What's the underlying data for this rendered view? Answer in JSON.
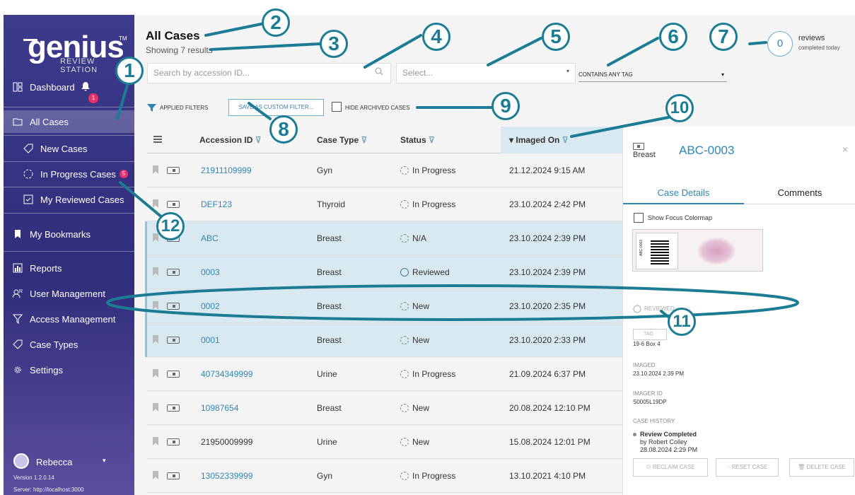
{
  "brand": {
    "name": "genius",
    "tm": "TM",
    "subtitle": "REVIEW STATION"
  },
  "sidebar": {
    "dashboard": {
      "label": "Dashboard",
      "bell_count": "1"
    },
    "items": [
      {
        "label": "All Cases",
        "icon": "folder-icon"
      },
      {
        "label": "New Cases",
        "icon": "tag-icon"
      },
      {
        "label": "In Progress Cases",
        "icon": "progress-icon",
        "badge": "5"
      },
      {
        "label": "My Reviewed Cases",
        "icon": "checkbox-icon"
      },
      {
        "label": "My Bookmarks",
        "icon": "bookmark-icon"
      },
      {
        "label": "Reports",
        "icon": "reports-icon"
      },
      {
        "label": "User Management",
        "icon": "users-icon"
      },
      {
        "label": "Access Management",
        "icon": "access-icon"
      },
      {
        "label": "Case Types",
        "icon": "tag-icon"
      },
      {
        "label": "Settings",
        "icon": "gear-icon"
      }
    ],
    "user": "Rebecca",
    "version": "Version 1.2.0.14",
    "server": "Server: http://localhost:3000"
  },
  "header": {
    "title": "All Cases",
    "results": "Showing 7 results",
    "search_placeholder": "Search by accession ID...",
    "select_placeholder": "Select...",
    "tag_mode": "CONTAINS ANY TAG",
    "reviews_count": "0",
    "reviews_label": "reviews",
    "reviews_sub": "completed today"
  },
  "filters": {
    "applied": "APPLIED FILTERS",
    "save_custom": "SAVE AS CUSTOM FILTER...",
    "hide_archived": "HIDE ARCHIVED CASES"
  },
  "table": {
    "columns": [
      "Accession ID",
      "Case Type",
      "Status",
      "Imaged On"
    ],
    "rows": [
      {
        "id": "21911109999",
        "type": "Gyn",
        "status": "In Progress",
        "date": "21.12.2024 9:15 AM"
      },
      {
        "id": "DEF123",
        "type": "Thyroid",
        "status": "In Progress",
        "date": "23.10.2024 2:42 PM"
      },
      {
        "id": "ABC",
        "type": "Breast",
        "status": "N/A",
        "date": "23.10.2024 2:39 PM"
      },
      {
        "id": "0003",
        "type": "Breast",
        "status": "Reviewed",
        "date": "23.10.2024 2:39 PM"
      },
      {
        "id": "0002",
        "type": "Breast",
        "status": "New",
        "date": "23.10.2020 2:35 PM"
      },
      {
        "id": "0001",
        "type": "Breast",
        "status": "New",
        "date": "23.10.2020 2:33 PM"
      },
      {
        "id": "40734349999",
        "type": "Urine",
        "status": "In Progress",
        "date": "21.09.2024 6:37 PM"
      },
      {
        "id": "10987654",
        "type": "Breast",
        "status": "New",
        "date": "20.08.2024 12:10 PM"
      },
      {
        "id": "21950009999",
        "type": "Urine",
        "status": "New",
        "date": "15.08.2024 12:01 PM"
      },
      {
        "id": "13052339999",
        "type": "Gyn",
        "status": "In Progress",
        "date": "13.10.2021 4:10 PM"
      }
    ]
  },
  "panel": {
    "type": "Breast",
    "id": "ABC-0003",
    "tabs": [
      "Case Details",
      "Comments"
    ],
    "colormap": "Show Focus Colormap",
    "slide_label": "ABC-0003",
    "status": "REVIEWED",
    "tag": "TAG",
    "box": "19-6 Box 4",
    "imaged_label": "IMAGED",
    "imaged_value": "23.10.2024 2:39 PM",
    "imager_label": "IMAGER ID",
    "imager_value": "S0005L19DP",
    "history_label": "CASE HISTORY",
    "history_title": "Review Completed",
    "history_by": "by Robert Colley",
    "history_date": "28.08.2024 2:29 PM",
    "reclaim": "RECLAIM CASE",
    "reset": "RESET CASE",
    "delete": "DELETE CASE"
  },
  "annotations": [
    "1",
    "2",
    "3",
    "4",
    "5",
    "6",
    "7",
    "8",
    "9",
    "10",
    "11",
    "12"
  ],
  "colors": {
    "accent": "#1c7c94",
    "link": "#2f86b3",
    "sidebar": "#3d3a8c",
    "badge": "#e8316a"
  }
}
